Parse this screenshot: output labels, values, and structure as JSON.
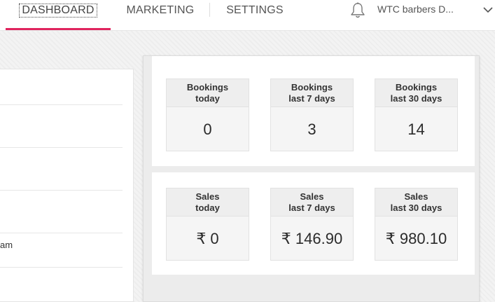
{
  "nav": {
    "tabs": [
      {
        "label": "DASHBOARD",
        "active": true
      },
      {
        "label": "MARKETING",
        "active": false
      },
      {
        "label": "SETTINGS",
        "active": false
      }
    ],
    "account_name": "WTC barbers D...",
    "icons": [
      "bell-icon",
      "chevron-down-icon"
    ],
    "accent_color": "#e0245e"
  },
  "left_panel": {
    "visible_text": "am"
  },
  "bookings": {
    "cards": [
      {
        "title": "Bookings\ntoday",
        "value": "0"
      },
      {
        "title": "Bookings\nlast 7 days",
        "value": "3"
      },
      {
        "title": "Bookings\nlast 30 days",
        "value": "14"
      }
    ]
  },
  "sales": {
    "cards": [
      {
        "title": "Sales\ntoday",
        "value": "₹ 0"
      },
      {
        "title": "Sales\nlast 7 days",
        "value": "₹ 146.90"
      },
      {
        "title": "Sales\nlast 30 days",
        "value": "₹ 980.10"
      }
    ]
  }
}
